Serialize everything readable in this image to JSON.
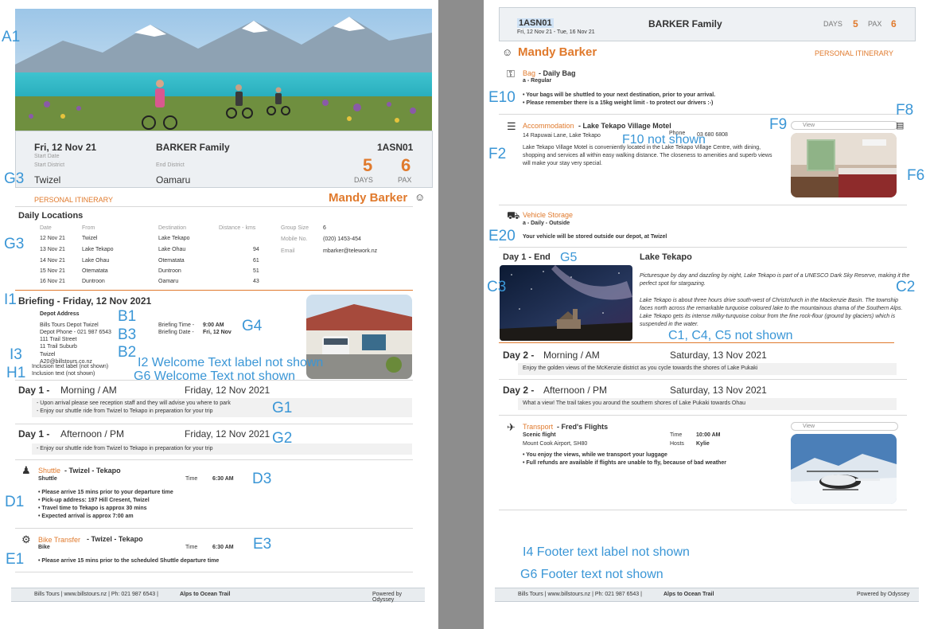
{
  "left": {
    "cover": {
      "date": "Fri, 12 Nov 21",
      "start_date_label": "Start Date",
      "start_district_label": "Start District",
      "start_district": "Twizel",
      "family": "BARKER Family",
      "end_district_label": "End District",
      "end_district": "Oamaru",
      "code": "1ASN01",
      "days": "5",
      "days_label": "DAYS",
      "pax": "6",
      "pax_label": "PAX"
    },
    "personal_itinerary": "PERSONAL ITINERARY",
    "traveller": "Mandy Barker",
    "daily_locations": {
      "title": "Daily Locations",
      "headers": [
        "Date",
        "From",
        "Destination",
        "Distance - kms"
      ],
      "rows": [
        [
          "12 Nov 21",
          "Twizel",
          "Lake Tekapo",
          ""
        ],
        [
          "13 Nov 21",
          "Lake Tekapo",
          "Lake Ohau",
          "94"
        ],
        [
          "14 Nov 21",
          "Lake Ohau",
          "Otematata",
          "61"
        ],
        [
          "15 Nov 21",
          "Otematata",
          "Duntroon",
          "51"
        ],
        [
          "16 Nov 21",
          "Duntroon",
          "Oamaru",
          "43"
        ]
      ],
      "group_size_label": "Group Size",
      "group_size": "6",
      "mobile_label": "Mobile No.",
      "mobile": "(020) 1453-454",
      "email_label": "Email",
      "email": "mbarker@telework.nz"
    },
    "briefing": {
      "title": "Briefing - Friday, 12 Nov 2021",
      "depot_label": "Depot Address",
      "depot_name": "Bills Tours Depot Twizel",
      "depot_phone": "Depot Phone - 021 987 6543",
      "addr1": "111 Trail Street",
      "addr2": "11 Trail Suburb",
      "addr3": "Twizel",
      "email": "A20@billstours.co.nz",
      "time_label": "Briefing Time -",
      "time": "9:00 AM",
      "date_label": "Briefing Date -",
      "date": "Fri, 12 Nov",
      "incl_label": "Inclusion text label (not shown)",
      "incl_text": "Inclusion text (not shown)"
    },
    "day1_am": {
      "day": "Day 1 -",
      "period": "Morning / AM",
      "date": "Friday, 12 Nov 2021",
      "line1": "- Upon arrival please see reception staff and they will advise you where to park",
      "line2": "- Enjoy our shuttle ride from Twizel to Tekapo in preparation for your trip"
    },
    "day1_pm": {
      "day": "Day 1 -",
      "period": "Afternoon / PM",
      "date": "Friday, 12 Nov 2021",
      "line1": "- Enjoy our shuttle ride from Twizel to Tekapo in preparation for your trip"
    },
    "shuttle": {
      "name": "Shuttle",
      "route": "- Twizel - Tekapo",
      "sub": "Shuttle",
      "time_label": "Time",
      "time": "6:30 AM",
      "b1": "• Please arrive 15 mins prior to your departure time",
      "b2": "• Pick-up address: 197 Hill Cresent, Twizel",
      "b3": "• Travel time to Tekapo is approx 30 mins",
      "b4": "• Expected arrival is approx 7:00 am"
    },
    "bike": {
      "name": "Bike Transfer",
      "route": "- Twizel - Tekapo",
      "sub": "Bike",
      "time_label": "Time",
      "time": "6:30 AM",
      "b1": "• Please arrive 15 mins prior to the scheduled Shuttle departure time"
    },
    "footer": {
      "left_text": "Bills Tours | www.billstours.nz | Ph: 021 987 6543 |",
      "left_bold": "Alps to Ocean Trail",
      "right": "Powered by Odyssey"
    }
  },
  "right": {
    "header": {
      "code": "1ASN01",
      "dates": "Fri, 12 Nov 21 - Tue, 16 Nov 21",
      "family": "BARKER Family",
      "days_label": "DAYS",
      "days": "5",
      "pax_label": "PAX",
      "pax": "6"
    },
    "traveller": "Mandy Barker",
    "personal_itinerary": "PERSONAL ITINERARY",
    "bag": {
      "name": "Bag",
      "title": "- Daily Bag",
      "sub": "a - Regular",
      "b1": "• Your bags will be shuttled to your next destination, prior to your arrival.",
      "b2": "• Please remember there is a 15kg weight limit - to protect our drivers  :-)"
    },
    "accommodation": {
      "name": "Accommodation",
      "title": "- Lake Tekapo Village Motel",
      "address": "14 Rapuwai Lane, Lake Tekapo",
      "phone_label": "Phone",
      "phone": "03 680 6808",
      "view": "View",
      "desc": "Lake Tekapo Village Motel is conveniently located in the Lake Tekapo Village Centre, with dining, shopping and services all within easy walking distance. The closeness to amenities and superb views will make your stay very special."
    },
    "vehicle": {
      "name": "Vehicle Storage",
      "sub": "a - Daily - Outside",
      "text": "Your vehicle will be stored outside our depot, at Twizel"
    },
    "day1_end": {
      "day": "Day 1 - End",
      "place": "Lake Tekapo",
      "p1": "Picturesque by day and dazzling by night, Lake Tekapo is part of a UNESCO Dark Sky Reserve, making it the perfect spot for stargazing.",
      "p2": "Lake Tekapo is about three hours drive south-west of Christchurch in the Mackenzie Basin. The township faces north across the remarkable turquoise coloured lake to the mountainous drama of the Southern Alps. Lake Tekapo gets its intense milky-turquoise colour from the fine rock-flour (ground by glaciers) which is suspended in the water."
    },
    "day2_am": {
      "day": "Day 2 -",
      "period": "Morning / AM",
      "date": "Saturday, 13 Nov 2021",
      "line1": "Enjoy the golden views of the McKenzie district as you cycle towards the shores of Lake Pukaki"
    },
    "day2_pm": {
      "day": "Day 2 -",
      "period": "Afternoon / PM",
      "date": "Saturday, 13 Nov 2021",
      "line1": "What a view!  The trail takes you around the southern shores of Lake Pukaki towards Ohau"
    },
    "transport": {
      "name": "Transport",
      "title": "- Fred's Flights",
      "sub": "Scenic flight",
      "location": "Mount Cook Airport, SH80",
      "time_label": "Time",
      "time": "10:00 AM",
      "hosts_label": "Hosts",
      "hosts": "Kylie",
      "view": "View",
      "b1": "• You enjoy the views, while we transport your luggage",
      "b2": "• Full refunds are available if flights are unable to fly, because of bad weather"
    },
    "footer": {
      "left_text": "Bills Tours | www.billstours.nz | Ph: 021 987 6543 |",
      "left_bold": "Alps to Ocean Trail",
      "right": "Powered by Odyssey"
    }
  },
  "annotations": {
    "A1": "A1",
    "G3a": "G3",
    "G3b": "G3",
    "I1": "I1",
    "B1": "B1",
    "B3": "B3",
    "B2": "B2",
    "G4": "G4",
    "I3": "I3",
    "H1": "H1",
    "I2": "I2 Welcome Text label not shown",
    "G6a": "G6 Welcome Text not shown",
    "G1": "G1",
    "G2": "G2",
    "D3": "D3",
    "D1": "D1",
    "E3": "E3",
    "E1": "E1",
    "E10": "E10",
    "F8": "F8",
    "F9": "F9",
    "F10": "F10 not shown",
    "F2": "F2",
    "F6": "F6",
    "E20": "E20",
    "G5": "G5",
    "C3": "C3",
    "C2": "C2",
    "C145": "C1, C4, C5 not shown",
    "I4": "I4 Footer text label not shown",
    "G6b": "G6 Footer text not shown"
  },
  "colors": {
    "accent": "#e07a2d",
    "annotation": "#3a96d6",
    "header_bg": "#eef1f4"
  }
}
